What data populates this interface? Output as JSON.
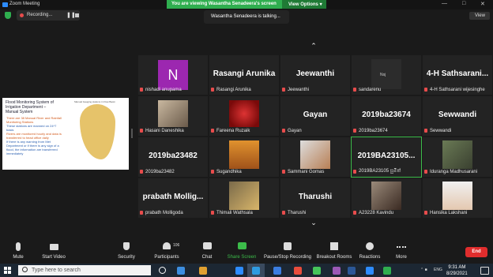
{
  "window": {
    "title": "Zoom Meeting"
  },
  "banner": {
    "text": "You are viewing Wasantha Senadeera's screen",
    "options": "View Options ▾"
  },
  "recording": {
    "label": "Recording..."
  },
  "talking": "Wasantha Senadeera is talking...",
  "view_button": "View",
  "shared_screen": {
    "heading": "Flood Monitoring System of Irrigation Department – Manual System",
    "map_caption": "Manual Gauging stations in Flow Basin",
    "bullets": [
      "There are 38 Manual River and Rainfall Monitoring Stations",
      "These stations are manned on 24*7 basis",
      "Rivers are monitored hourly and data is transferred to head office daily",
      "If there is any warning from Met Department or if there is any sign of a flood, the information are transferred immediately"
    ]
  },
  "participants": [
    {
      "name": "nishadi anupama",
      "initial": "N"
    },
    {
      "name": "Rasangi Arunika",
      "display": "Rasangi Arunika"
    },
    {
      "name": "Jeewanthi",
      "display": "Jeewanthi"
    },
    {
      "name": "sandarenu",
      "tag": "Nsj"
    },
    {
      "name": "4-H Sathsarani wijesinghe",
      "display": "4-H Sathsarani..."
    },
    {
      "name": "Hasani Daneshika"
    },
    {
      "name": "Fareena Ruzaik"
    },
    {
      "name": "Gayan",
      "display": "Gayan"
    },
    {
      "name": "2019ba23674",
      "display": "2019ba23674"
    },
    {
      "name": "Sewwandi",
      "display": "Sewwandi"
    },
    {
      "name": "2019ba23482",
      "display": "2019ba23482"
    },
    {
      "name": "Sugandhika"
    },
    {
      "name": "Sammani Gomas"
    },
    {
      "name": "2019BA23105 සුමිත්",
      "display": "2019BA23105..."
    },
    {
      "name": "Iduranga Madhusarani"
    },
    {
      "name": "prabath Molligoda",
      "display": "prabath Mollig..."
    },
    {
      "name": "Thimali Wathsala"
    },
    {
      "name": "Tharushi",
      "display": "Tharushi"
    },
    {
      "name": "A23228 Kavindu"
    },
    {
      "name": "Hansika Lakshani"
    }
  ],
  "controls": {
    "mute": "Mute",
    "start_video": "Start Video",
    "security": "Security",
    "participants": "Participants",
    "participant_count": "106",
    "chat": "Chat",
    "share_screen": "Share Screen",
    "record": "Pause/Stop Recording",
    "breakout": "Breakout Rooms",
    "reactions": "Reactions",
    "more": "More",
    "end": "End"
  },
  "taskbar": {
    "search_placeholder": "Type here to search",
    "language": "ENG",
    "time": "9:31 AM",
    "date": "8/29/2021",
    "icon_colors": [
      "#ffffff",
      "#3d8ee0",
      "#e0a030",
      "#2d8cff",
      "#2f9be0",
      "#3b7de0",
      "#e84c3c",
      "#45c45a",
      "#9b59b6",
      "#2b5797",
      "#2d8cff",
      "#2fae4f"
    ]
  }
}
